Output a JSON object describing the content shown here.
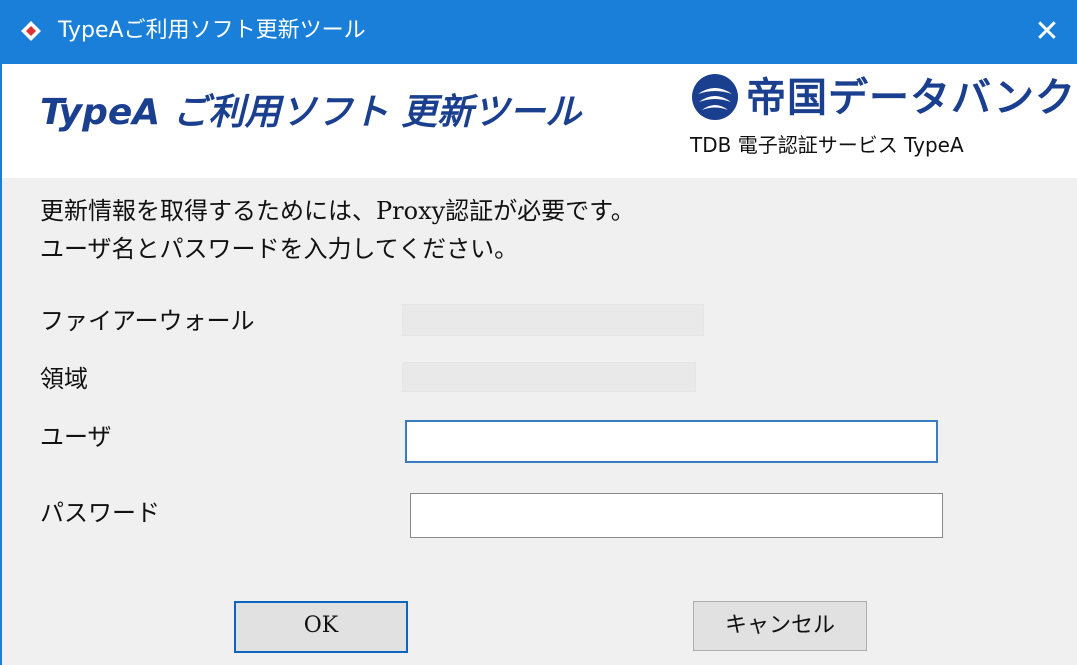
{
  "window": {
    "title": "TypeAご利用ソフト更新ツール",
    "close_glyph": "✕",
    "icon": "tool-icon"
  },
  "header": {
    "heading": "TypeA ご利用ソフト 更新ツール",
    "logo_text": "帝国データバンク",
    "subtitle": "TDB 電子認証サービス TypeA"
  },
  "message": {
    "line1": "更新情報を取得するためには、Proxy認証が必要です。",
    "line2": "ユーザ名とパスワードを入力してください。"
  },
  "form": {
    "firewall_label": "ファイアーウォール",
    "firewall_value": "",
    "realm_label": "領域",
    "realm_value": "",
    "user_label": "ユーザ",
    "user_value": "",
    "password_label": "パスワード",
    "password_value": ""
  },
  "buttons": {
    "ok": "OK",
    "cancel": "キャンセル"
  },
  "colors": {
    "titlebar": "#1a7fd8",
    "heading": "#1b3f8f",
    "focus_border": "#3a7cc0"
  }
}
